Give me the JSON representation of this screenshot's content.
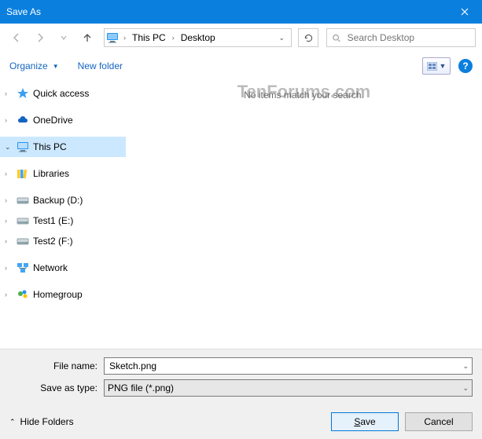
{
  "title": "Save As",
  "nav": {
    "breadcrumb": {
      "root": "This PC",
      "leaf": "Desktop"
    },
    "search_placeholder": "Search Desktop"
  },
  "toolbar": {
    "organize": "Organize",
    "new_folder": "New folder"
  },
  "tree": {
    "quick_access": "Quick access",
    "onedrive": "OneDrive",
    "this_pc": "This PC",
    "libraries": "Libraries",
    "backup": "Backup (D:)",
    "test1": "Test1 (E:)",
    "test2": "Test2 (F:)",
    "network": "Network",
    "homegroup": "Homegroup"
  },
  "content": {
    "empty": "No items match your search."
  },
  "watermark": "TenForums.com",
  "form": {
    "file_name_label": "File name:",
    "file_name_value": "Sketch.png",
    "save_type_label": "Save as type:",
    "save_type_value": "PNG file (*.png)",
    "hide_folders": "Hide Folders",
    "save": "Save",
    "cancel": "Cancel"
  }
}
